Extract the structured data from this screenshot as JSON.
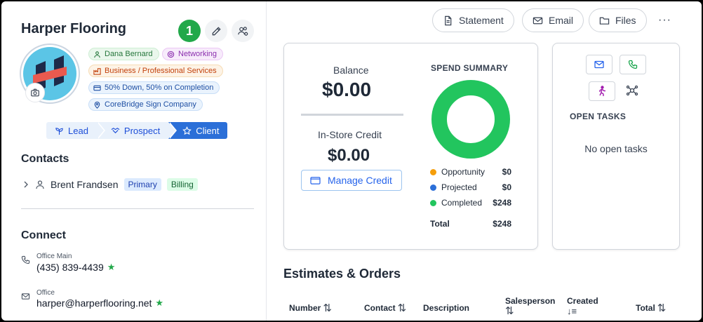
{
  "company": {
    "name": "Harper Flooring",
    "notification_count": "1"
  },
  "tags": [
    {
      "label": "Dana Bernard",
      "icon": "person-icon",
      "color": "#25763b"
    },
    {
      "label": "Networking",
      "icon": "target-icon",
      "color": "#8b2fae"
    },
    {
      "label": "Business / Professional Services",
      "icon": "industry-icon",
      "color": "#c2410c"
    },
    {
      "label": "50% Down, 50% on Completion",
      "icon": "payment-terms-icon",
      "color": "#1e4fa3"
    },
    {
      "label": "CoreBridge Sign Company",
      "icon": "location-pin-icon",
      "color": "#1e4fa3"
    }
  ],
  "pipeline": {
    "stages": [
      "Lead",
      "Prospect",
      "Client"
    ],
    "active": "Client"
  },
  "contacts": {
    "title": "Contacts",
    "items": [
      {
        "name": "Brent Frandsen",
        "badges": [
          "Primary",
          "Billing"
        ]
      }
    ]
  },
  "connect": {
    "title": "Connect",
    "items": [
      {
        "label": "Office Main",
        "value": "(435) 839-4439"
      },
      {
        "label": "Office",
        "value": "harper@harperflooring.net"
      }
    ]
  },
  "toolbar": {
    "statement": "Statement",
    "email": "Email",
    "files": "Files",
    "more": "···"
  },
  "balance": {
    "balance_label": "Balance",
    "balance_value": "$0.00",
    "credit_label": "In-Store Credit",
    "credit_value": "$0.00",
    "manage_credit": "Manage Credit"
  },
  "spend_summary": {
    "title": "SPEND SUMMARY",
    "total_label": "Total",
    "total_value": "$248"
  },
  "chart_data": {
    "type": "pie",
    "title": "SPEND SUMMARY",
    "categories": [
      "Opportunity",
      "Projected",
      "Completed"
    ],
    "values": [
      0,
      0,
      248
    ],
    "value_labels": [
      "$0",
      "$0",
      "$248"
    ],
    "colors": [
      "#f59e0b",
      "#2b6fd8",
      "#22c55e"
    ],
    "donut": true,
    "legend": "bottom"
  },
  "tasks": {
    "title": "OPEN TASKS",
    "empty_text": "No open tasks"
  },
  "estimates": {
    "title": "Estimates & Orders",
    "columns": [
      "Number",
      "Contact",
      "Description",
      "Salesperson",
      "Created",
      "Total"
    ]
  },
  "colors": {
    "accent": "#2b6fd8",
    "success": "#22a84a"
  }
}
